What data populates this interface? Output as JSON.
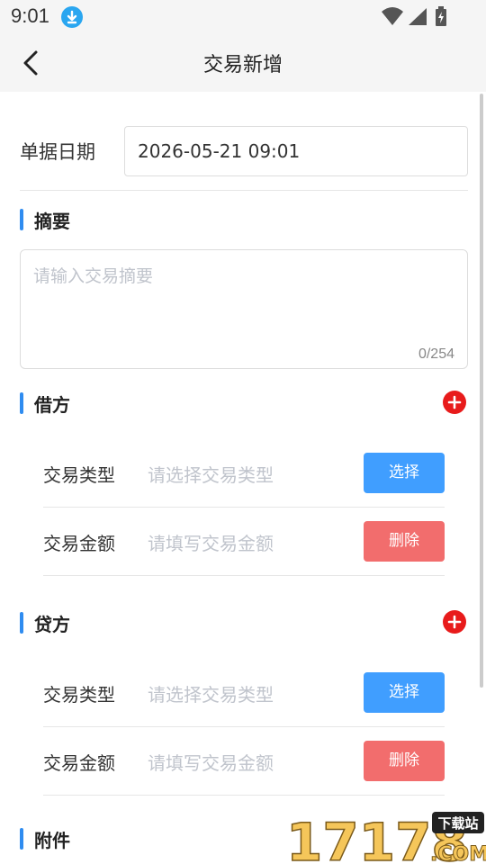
{
  "status_bar": {
    "time": "9:01",
    "download_icon": "download-icon",
    "wifi_icon": "wifi-icon",
    "signal_icon": "signal-icon",
    "battery_icon": "battery-charging-icon"
  },
  "header": {
    "title": "交易新增",
    "back_icon": "chevron-left-icon"
  },
  "form": {
    "date_label": "单据日期",
    "date_value": "2026-05-21 09:01",
    "summary": {
      "title": "摘要",
      "placeholder": "请输入交易摘要",
      "value": "",
      "counter": "0/254"
    },
    "debit": {
      "title": "借方",
      "add_icon": "add-circle-icon",
      "rows": [
        {
          "label": "交易类型",
          "placeholder": "请选择交易类型",
          "button": "选择"
        },
        {
          "label": "交易金额",
          "placeholder": "请填写交易金额",
          "button": "删除"
        }
      ]
    },
    "credit": {
      "title": "贷方",
      "add_icon": "add-circle-icon",
      "rows": [
        {
          "label": "交易类型",
          "placeholder": "请选择交易类型",
          "button": "选择"
        },
        {
          "label": "交易金额",
          "placeholder": "请填写交易金额",
          "button": "删除"
        }
      ]
    },
    "attachment": {
      "title": "附件"
    }
  },
  "watermark": {
    "number": "17178",
    "badge": "下载站",
    "domain": ".COM"
  },
  "colors": {
    "accent_blue": "#409eff",
    "delete_red": "#f26d6d",
    "add_red": "#e81b1b",
    "section_bar": "#2f8cf0",
    "header_bg": "#f5f5f5"
  }
}
